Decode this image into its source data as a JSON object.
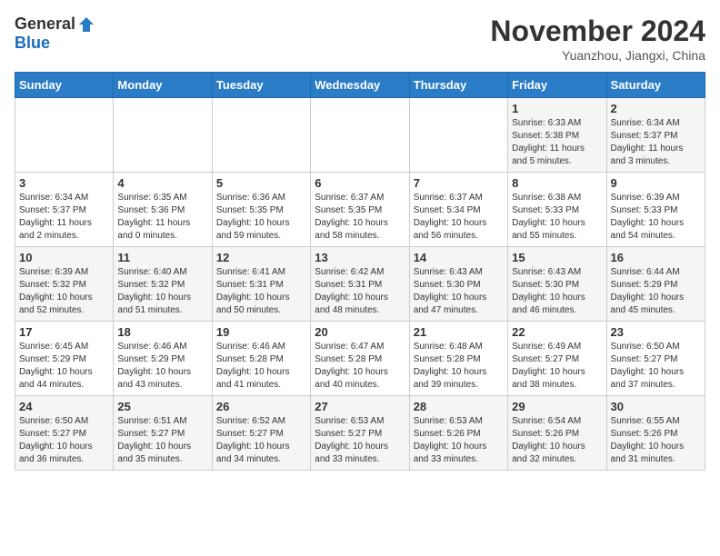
{
  "header": {
    "logo_general": "General",
    "logo_blue": "Blue",
    "month_title": "November 2024",
    "location": "Yuanzhou, Jiangxi, China"
  },
  "weekdays": [
    "Sunday",
    "Monday",
    "Tuesday",
    "Wednesday",
    "Thursday",
    "Friday",
    "Saturday"
  ],
  "weeks": [
    [
      {
        "day": "",
        "info": ""
      },
      {
        "day": "",
        "info": ""
      },
      {
        "day": "",
        "info": ""
      },
      {
        "day": "",
        "info": ""
      },
      {
        "day": "",
        "info": ""
      },
      {
        "day": "1",
        "info": "Sunrise: 6:33 AM\nSunset: 5:38 PM\nDaylight: 11 hours\nand 5 minutes."
      },
      {
        "day": "2",
        "info": "Sunrise: 6:34 AM\nSunset: 5:37 PM\nDaylight: 11 hours\nand 3 minutes."
      }
    ],
    [
      {
        "day": "3",
        "info": "Sunrise: 6:34 AM\nSunset: 5:37 PM\nDaylight: 11 hours\nand 2 minutes."
      },
      {
        "day": "4",
        "info": "Sunrise: 6:35 AM\nSunset: 5:36 PM\nDaylight: 11 hours\nand 0 minutes."
      },
      {
        "day": "5",
        "info": "Sunrise: 6:36 AM\nSunset: 5:35 PM\nDaylight: 10 hours\nand 59 minutes."
      },
      {
        "day": "6",
        "info": "Sunrise: 6:37 AM\nSunset: 5:35 PM\nDaylight: 10 hours\nand 58 minutes."
      },
      {
        "day": "7",
        "info": "Sunrise: 6:37 AM\nSunset: 5:34 PM\nDaylight: 10 hours\nand 56 minutes."
      },
      {
        "day": "8",
        "info": "Sunrise: 6:38 AM\nSunset: 5:33 PM\nDaylight: 10 hours\nand 55 minutes."
      },
      {
        "day": "9",
        "info": "Sunrise: 6:39 AM\nSunset: 5:33 PM\nDaylight: 10 hours\nand 54 minutes."
      }
    ],
    [
      {
        "day": "10",
        "info": "Sunrise: 6:39 AM\nSunset: 5:32 PM\nDaylight: 10 hours\nand 52 minutes."
      },
      {
        "day": "11",
        "info": "Sunrise: 6:40 AM\nSunset: 5:32 PM\nDaylight: 10 hours\nand 51 minutes."
      },
      {
        "day": "12",
        "info": "Sunrise: 6:41 AM\nSunset: 5:31 PM\nDaylight: 10 hours\nand 50 minutes."
      },
      {
        "day": "13",
        "info": "Sunrise: 6:42 AM\nSunset: 5:31 PM\nDaylight: 10 hours\nand 48 minutes."
      },
      {
        "day": "14",
        "info": "Sunrise: 6:43 AM\nSunset: 5:30 PM\nDaylight: 10 hours\nand 47 minutes."
      },
      {
        "day": "15",
        "info": "Sunrise: 6:43 AM\nSunset: 5:30 PM\nDaylight: 10 hours\nand 46 minutes."
      },
      {
        "day": "16",
        "info": "Sunrise: 6:44 AM\nSunset: 5:29 PM\nDaylight: 10 hours\nand 45 minutes."
      }
    ],
    [
      {
        "day": "17",
        "info": "Sunrise: 6:45 AM\nSunset: 5:29 PM\nDaylight: 10 hours\nand 44 minutes."
      },
      {
        "day": "18",
        "info": "Sunrise: 6:46 AM\nSunset: 5:29 PM\nDaylight: 10 hours\nand 43 minutes."
      },
      {
        "day": "19",
        "info": "Sunrise: 6:46 AM\nSunset: 5:28 PM\nDaylight: 10 hours\nand 41 minutes."
      },
      {
        "day": "20",
        "info": "Sunrise: 6:47 AM\nSunset: 5:28 PM\nDaylight: 10 hours\nand 40 minutes."
      },
      {
        "day": "21",
        "info": "Sunrise: 6:48 AM\nSunset: 5:28 PM\nDaylight: 10 hours\nand 39 minutes."
      },
      {
        "day": "22",
        "info": "Sunrise: 6:49 AM\nSunset: 5:27 PM\nDaylight: 10 hours\nand 38 minutes."
      },
      {
        "day": "23",
        "info": "Sunrise: 6:50 AM\nSunset: 5:27 PM\nDaylight: 10 hours\nand 37 minutes."
      }
    ],
    [
      {
        "day": "24",
        "info": "Sunrise: 6:50 AM\nSunset: 5:27 PM\nDaylight: 10 hours\nand 36 minutes."
      },
      {
        "day": "25",
        "info": "Sunrise: 6:51 AM\nSunset: 5:27 PM\nDaylight: 10 hours\nand 35 minutes."
      },
      {
        "day": "26",
        "info": "Sunrise: 6:52 AM\nSunset: 5:27 PM\nDaylight: 10 hours\nand 34 minutes."
      },
      {
        "day": "27",
        "info": "Sunrise: 6:53 AM\nSunset: 5:27 PM\nDaylight: 10 hours\nand 33 minutes."
      },
      {
        "day": "28",
        "info": "Sunrise: 6:53 AM\nSunset: 5:26 PM\nDaylight: 10 hours\nand 33 minutes."
      },
      {
        "day": "29",
        "info": "Sunrise: 6:54 AM\nSunset: 5:26 PM\nDaylight: 10 hours\nand 32 minutes."
      },
      {
        "day": "30",
        "info": "Sunrise: 6:55 AM\nSunset: 5:26 PM\nDaylight: 10 hours\nand 31 minutes."
      }
    ]
  ]
}
